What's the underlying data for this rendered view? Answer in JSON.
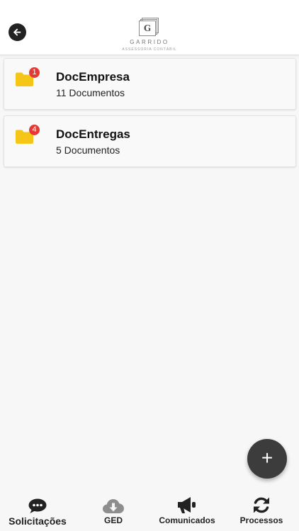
{
  "header": {
    "back_icon": "arrow-left-icon",
    "logo": {
      "mark": "G",
      "name": "GARRIDO",
      "subtitle": "ASSESSORIA CONTÁBIL"
    }
  },
  "folders": [
    {
      "name": "DocEmpresa",
      "count_label": "11 Documentos",
      "badge": "1",
      "icon": "folder-icon"
    },
    {
      "name": "DocEntregas",
      "count_label": "5 Documentos",
      "badge": "4",
      "icon": "folder-icon"
    }
  ],
  "fab": {
    "label": "+",
    "icon": "plus-icon"
  },
  "tabbar": {
    "items": [
      {
        "label": "Solicitações",
        "icon": "chat-bubble-icon",
        "active": true
      },
      {
        "label": "GED",
        "icon": "cloud-download-icon",
        "active": false
      },
      {
        "label": "Comunicados",
        "icon": "megaphone-icon",
        "active": false
      },
      {
        "label": "Processos",
        "icon": "sync-icon",
        "active": false
      }
    ]
  },
  "colors": {
    "folder": "#F5C518",
    "badge": "#E53935",
    "fab": "#3C3C3C",
    "icon_dark": "#222222",
    "icon_inactive": "#8E8E8E"
  }
}
